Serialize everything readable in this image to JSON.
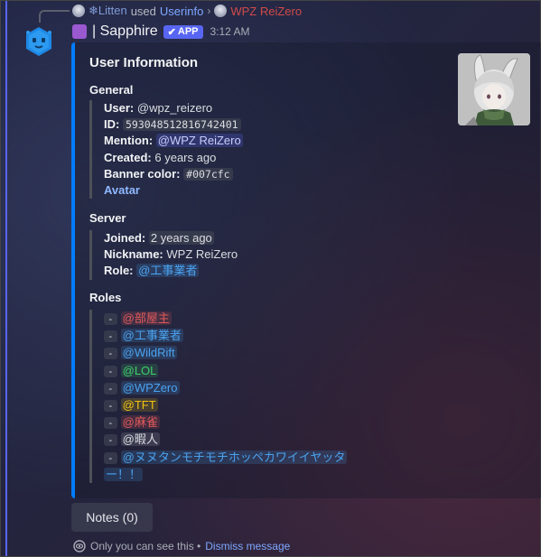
{
  "reply": {
    "user": "❄Litten",
    "used_text": "used",
    "command": "Userinfo",
    "chevron": "›",
    "target": "WPZ ReiZero"
  },
  "message": {
    "bot_name": "| Sapphire",
    "badge_check": "✔",
    "badge": "APP",
    "time": "3:12 AM"
  },
  "embed": {
    "accent_color": "#007cfc",
    "title": "User Information",
    "general": {
      "heading": "General",
      "user_label": "User:",
      "user_value": "@wpz_reizero",
      "id_label": "ID:",
      "id_value": "593048512816742401",
      "mention_label": "Mention:",
      "mention_value": "@WPZ ReiZero",
      "created_label": "Created:",
      "created_value": "6 years ago",
      "banner_label": "Banner color:",
      "banner_value": "#007cfc",
      "avatar_link": "Avatar"
    },
    "server": {
      "heading": "Server",
      "joined_label": "Joined:",
      "joined_value": "2 years ago",
      "nickname_label": "Nickname:",
      "nickname_value": "WPZ ReiZero",
      "role_label": "Role:",
      "role_value": "@工事業者"
    },
    "roles": {
      "heading": "Roles",
      "dash": "-",
      "items": [
        {
          "name": "@部屋主",
          "color": "#e05a5a",
          "bg": "rgba(224,90,90,0.18)"
        },
        {
          "name": "@工事業者",
          "color": "#4aa3f0",
          "bg": "rgba(74,163,240,0.18)"
        },
        {
          "name": "@WildRift",
          "color": "#4aa3f0",
          "bg": "rgba(74,163,240,0.18)"
        },
        {
          "name": "@LOL",
          "color": "#3fcf6a",
          "bg": "rgba(63,207,106,0.16)"
        },
        {
          "name": "@WPZero",
          "color": "#4aa3f0",
          "bg": "rgba(74,163,240,0.18)"
        },
        {
          "name": "@TFT",
          "color": "#f1c40f",
          "bg": "rgba(241,196,15,0.18)"
        },
        {
          "name": "@麻雀",
          "color": "#e05a5a",
          "bg": "rgba(224,90,90,0.18)"
        },
        {
          "name": "@暇人",
          "color": "#dbdee1",
          "bg": "rgba(120,124,140,0.3)"
        },
        {
          "name": "@ヌヌタンモチモチホッペカワイイヤッタ",
          "color": "#4aa3f0",
          "bg": "rgba(74,163,240,0.18)"
        },
        {
          "name": "ー！！",
          "color": "#4aa3f0",
          "bg": "rgba(74,163,240,0.18)"
        }
      ]
    }
  },
  "notes_button": "Notes (0)",
  "ephemeral": {
    "text": "Only you can see this •",
    "dismiss": "Dismiss message"
  },
  "icons": {
    "bot_avatar": "blue-hexagon-bot-icon",
    "eye": "eye-icon"
  }
}
